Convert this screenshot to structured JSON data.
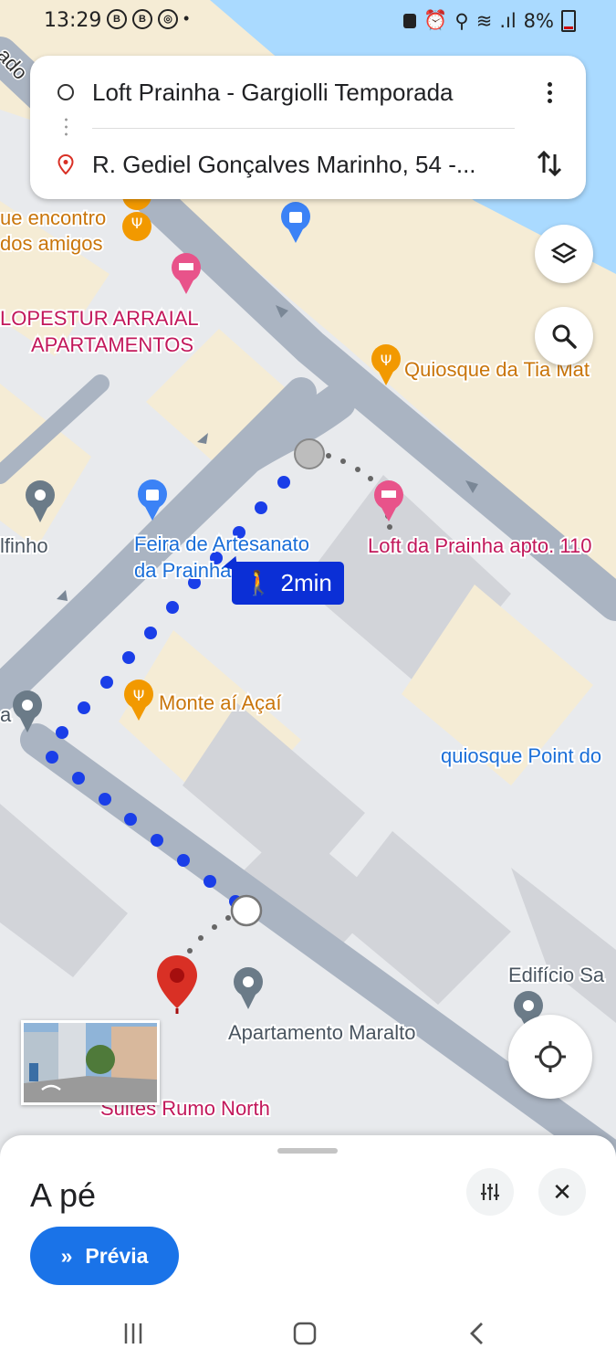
{
  "status_bar": {
    "time": "13:29",
    "left_icons": [
      "B",
      "B",
      "◎"
    ],
    "battery": "8%"
  },
  "route": {
    "origin": "Loft Prainha - Gargiolli Temporada",
    "destination": "R. Gediel Gonçalves Marinho, 54 -...",
    "menu_icon": "more-vert-icon",
    "swap_icon": "swap-icon"
  },
  "map": {
    "poi_labels": {
      "encontro_1": "ue encontro",
      "encontro_2": "dos amigos",
      "lopestur_1": "LOPESTUR ARRAIAL",
      "lopestur_2": "APARTAMENTOS",
      "quiosque_tia": "Quiosque da Tia Mat",
      "golfinho": "lfinho",
      "feira_1": "Feira de Artesanato",
      "feira_2": "da Prainha",
      "loft": "Loft da Prainha apto. 110",
      "monte": "Monte aí Açaí",
      "quiosque_point": "quiosque Point do",
      "edificio": "Edifício Sa",
      "maralto": "Apartamento Maralto",
      "suites": "Suites Rumo North",
      "street": "ado",
      "small_a": "a"
    },
    "walk_duration": "2min",
    "colors": {
      "water": "#aadaff",
      "beach": "#f5ecd5",
      "road": "#aab4c2",
      "block": "#dfe1e5",
      "building": "#d2d4d9",
      "route_dot": "#1a3ee8",
      "food_pin": "#f29900",
      "hotel_pin": "#e8538a",
      "shop_pin": "#3b82f6",
      "generic_pin": "#6b7b88",
      "destination_pin": "#d93025"
    }
  },
  "sheet": {
    "mode_title": "A pé",
    "preview_label": "Prévia",
    "close_label": "✕"
  }
}
